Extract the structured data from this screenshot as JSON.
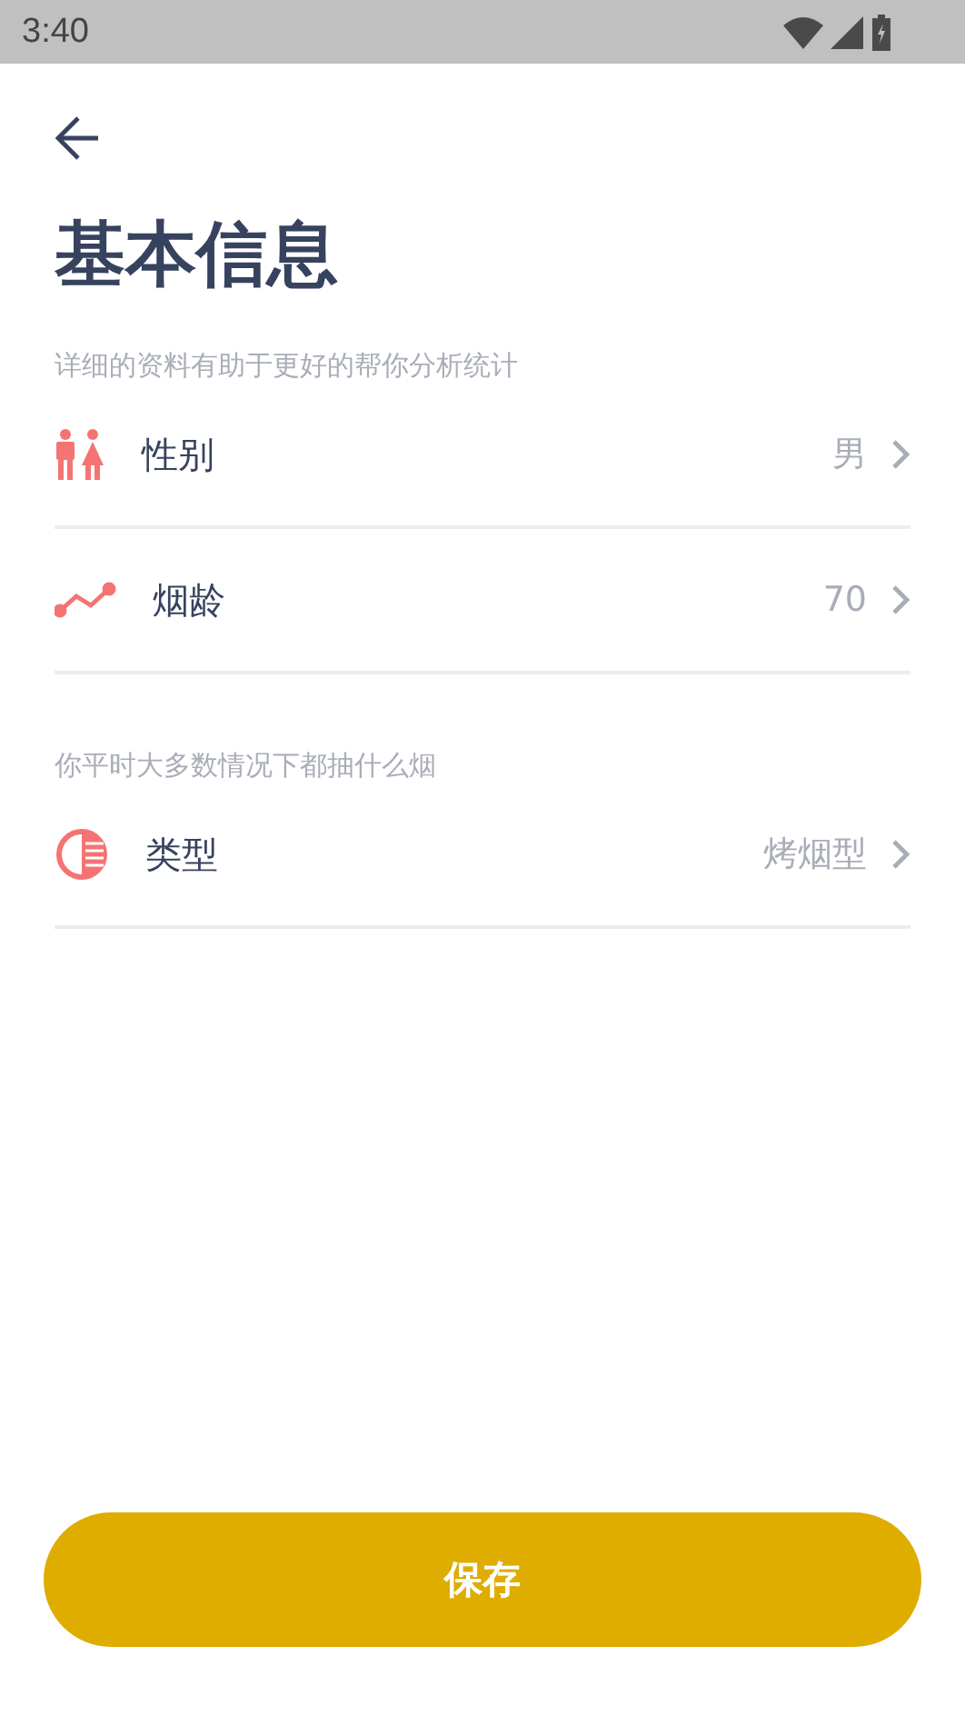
{
  "status_bar": {
    "time": "3:40"
  },
  "title": "基本信息",
  "sections": [
    {
      "caption": "详细的资料有助于更好的帮你分析统计",
      "rows": [
        {
          "kind": "gender",
          "label": "性别",
          "value": "男"
        },
        {
          "kind": "trend",
          "label": "烟龄",
          "value": "70"
        }
      ]
    },
    {
      "caption": "你平时大多数情况下都抽什么烟",
      "rows": [
        {
          "kind": "type",
          "label": "类型",
          "value": "烤烟型"
        }
      ]
    }
  ],
  "save_button": "保存"
}
